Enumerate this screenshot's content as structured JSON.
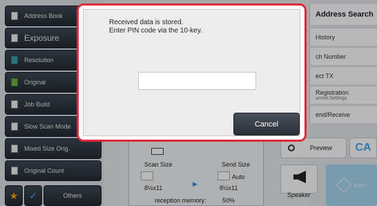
{
  "left_menu": {
    "items": [
      {
        "label": "Address Book"
      },
      {
        "label": "Exposure"
      },
      {
        "label": "Resolution"
      },
      {
        "label": "Original"
      },
      {
        "label": "Job Build"
      },
      {
        "label": "Slow Scan Mode"
      },
      {
        "label": "Mixed Size Orig."
      },
      {
        "label": "Original Count"
      }
    ],
    "others_label": "Others"
  },
  "right_menu": {
    "title": "Address Search",
    "items": [
      {
        "label": "History"
      },
      {
        "label": "ch Number"
      },
      {
        "label": "ect TX"
      },
      {
        "label": "Registration",
        "sub": "urrent Settings"
      },
      {
        "label": "end/Receive"
      }
    ]
  },
  "scan_panel": {
    "scan_size_label": "Scan Size",
    "send_size_label": "Send Size",
    "send_size_mode": "Auto",
    "scan_size_value": "8½x11",
    "send_size_value": "8½x11",
    "memory_label": "reception memory:",
    "memory_value": "50%"
  },
  "actions": {
    "preview_label": "Preview",
    "ca_label": "CA",
    "speaker_label": "Speaker",
    "start_label": "Start"
  },
  "dialog": {
    "line1": "Received data is stored.",
    "line2": "Enter PIN code via the 10-key.",
    "pin_value": "",
    "cancel_label": "Cancel"
  },
  "colors": {
    "dialog_border": "#e0283c",
    "accent_blue": "#3fa9f5",
    "start_button": "#a9d6f2"
  }
}
